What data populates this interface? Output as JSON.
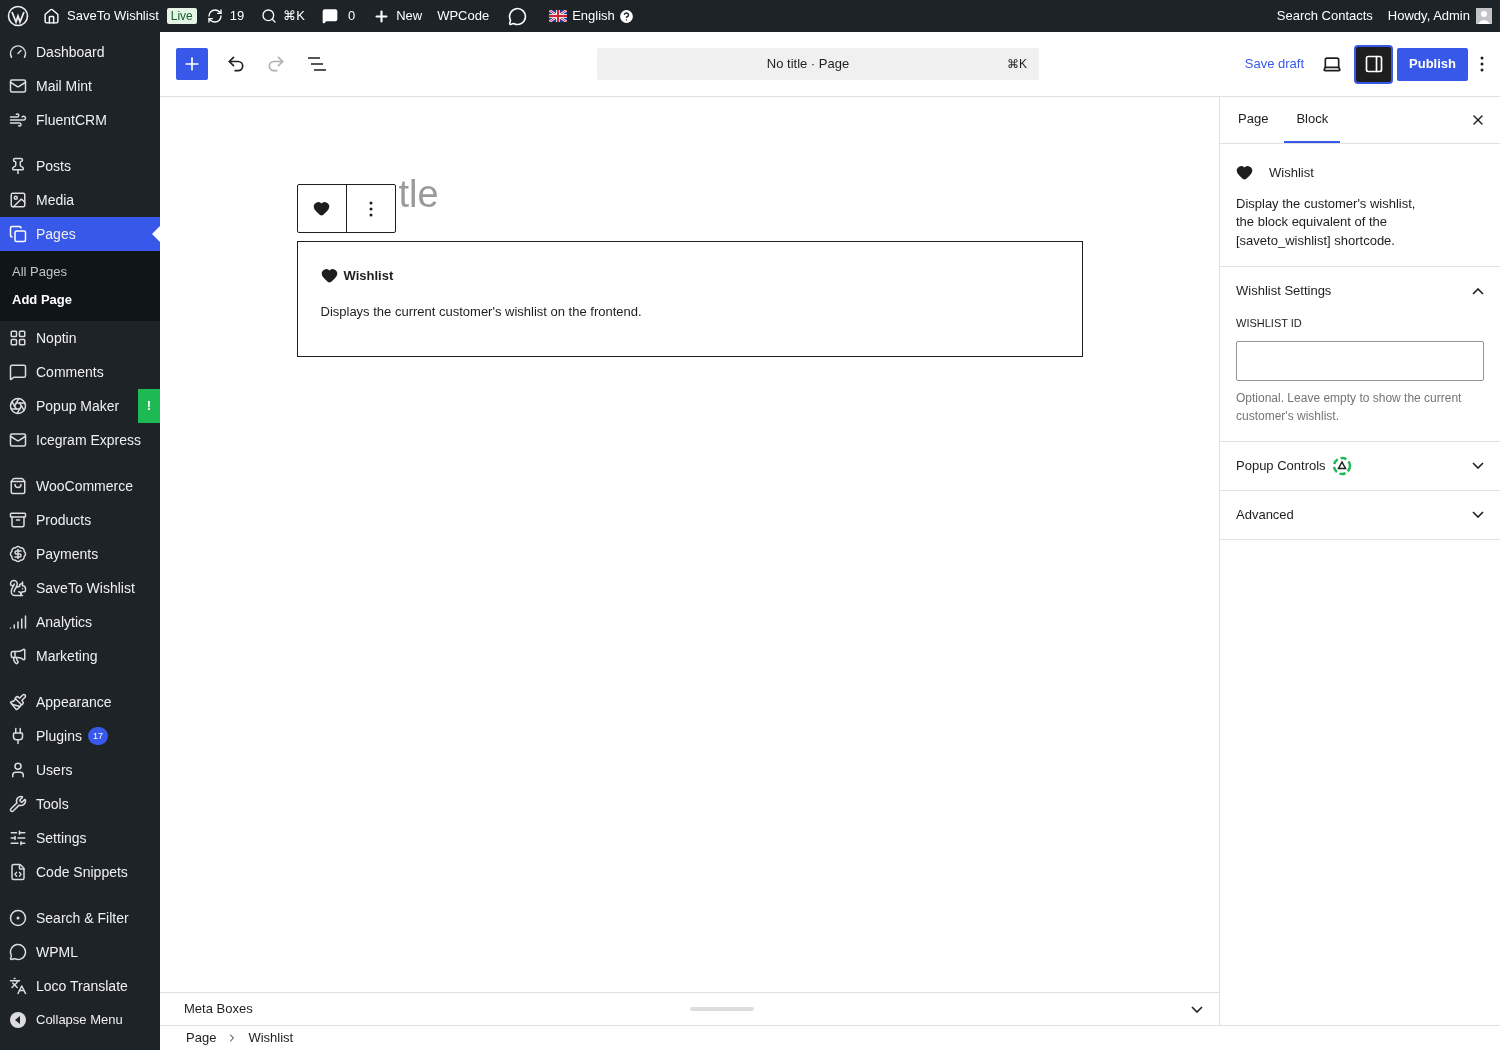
{
  "admin_bar": {
    "site": "SaveTo Wishlist",
    "status_badge": "Live",
    "updates": "19",
    "search_shortcut": "⌘K",
    "comments": "0",
    "new": "New",
    "wpcode": "WPCode",
    "language": "English",
    "search_contacts": "Search Contacts",
    "greeting": "Howdy, Admin"
  },
  "sidebar": {
    "groups": [
      [
        {
          "label": "Dashboard",
          "selected": false
        },
        {
          "label": "Mail Mint",
          "selected": false
        },
        {
          "label": "FluentCRM",
          "selected": false
        }
      ],
      [
        {
          "label": "Posts",
          "selected": false
        },
        {
          "label": "Media",
          "selected": false
        },
        {
          "label": "Pages",
          "selected": true,
          "children": [
            {
              "label": "All Pages",
              "selected": false
            },
            {
              "label": "Add Page",
              "selected": true
            }
          ]
        },
        {
          "label": "Noptin",
          "selected": false
        },
        {
          "label": "Comments",
          "selected": false
        },
        {
          "label": "Popup Maker",
          "selected": false,
          "alert": "!"
        },
        {
          "label": "Icegram Express",
          "selected": false
        }
      ],
      [
        {
          "label": "WooCommerce",
          "selected": false
        },
        {
          "label": "Products",
          "selected": false
        },
        {
          "label": "Payments",
          "selected": false
        },
        {
          "label": "SaveTo Wishlist",
          "selected": false
        },
        {
          "label": "Analytics",
          "selected": false
        },
        {
          "label": "Marketing",
          "selected": false
        }
      ],
      [
        {
          "label": "Appearance",
          "selected": false
        },
        {
          "label": "Plugins",
          "selected": false,
          "badge": "17"
        },
        {
          "label": "Users",
          "selected": false
        },
        {
          "label": "Tools",
          "selected": false
        },
        {
          "label": "Settings",
          "selected": false
        },
        {
          "label": "Code Snippets",
          "selected": false
        }
      ],
      [
        {
          "label": "Search & Filter",
          "selected": false
        },
        {
          "label": "WPML",
          "selected": false
        },
        {
          "label": "Loco Translate",
          "selected": false
        }
      ]
    ],
    "collapse": "Collapse Menu"
  },
  "toolbar": {
    "document_title": "No title · Page",
    "shortcut": "⌘K",
    "save_draft": "Save draft",
    "publish": "Publish",
    "settings_open": true
  },
  "editor": {
    "title_placeholder": "tle",
    "block": {
      "title": "Wishlist",
      "description": "Displays the current customer's wishlist on the frontend."
    }
  },
  "inspector": {
    "tabs": [
      {
        "label": "Page",
        "selected": false
      },
      {
        "label": "Block",
        "selected": true
      }
    ],
    "block": {
      "name": "Wishlist",
      "description": "Display the customer's wishlist, the block equivalent of the [saveto_wishlist] shortcode."
    },
    "panels": [
      {
        "title": "Wishlist Settings",
        "expanded": true,
        "field": {
          "label": "WISHLIST ID",
          "help": "Optional. Leave empty to show the current customer's wishlist."
        }
      },
      {
        "title": "Popup Controls",
        "expanded": false
      },
      {
        "title": "Advanced",
        "expanded": false
      }
    ]
  },
  "meta_boxes": "Meta Boxes",
  "breadcrumb": [
    "Page",
    "Wishlist"
  ]
}
